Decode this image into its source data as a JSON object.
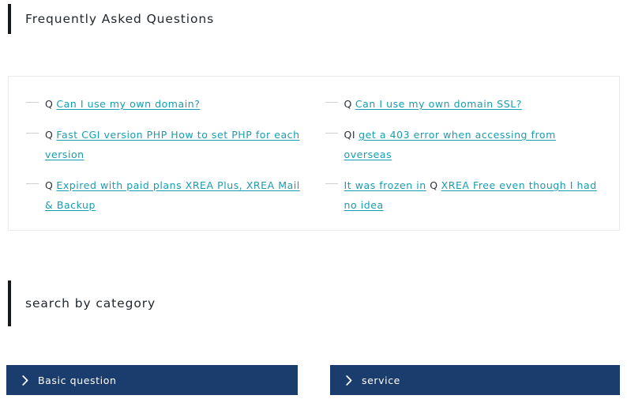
{
  "colors": {
    "accent_bar": "#15191d",
    "link": "#1a9cb0",
    "button_bg": "#1a3d6d",
    "card_border": "#ebebeb",
    "page_bg": "#ffffff",
    "text": "#22282d"
  },
  "faq_section": {
    "heading": "Frequently Asked Questions",
    "columns": [
      {
        "items": [
          {
            "marker": "Q",
            "parts": [
              {
                "type": "link",
                "text": "Can I use my own domain?"
              }
            ]
          },
          {
            "marker": "Q",
            "parts": [
              {
                "type": "link",
                "text": "Fast CGI version PHP How to set PHP for each version"
              }
            ]
          },
          {
            "marker": "Q",
            "parts": [
              {
                "type": "link",
                "text": "Expired with paid plans XREA Plus, XREA Mail & Backup"
              }
            ]
          }
        ]
      },
      {
        "items": [
          {
            "marker": "Q",
            "parts": [
              {
                "type": "link",
                "text": "Can I use my own domain SSL?"
              }
            ]
          },
          {
            "marker": "QI",
            "parts": [
              {
                "type": "link",
                "text": "get a 403 error when accessing from overseas"
              }
            ]
          },
          {
            "marker": "",
            "parts": [
              {
                "type": "link",
                "text": "It was frozen in"
              },
              {
                "type": "text",
                "text": "Q"
              },
              {
                "type": "link",
                "text": "XREA Free even though I had no idea"
              }
            ]
          }
        ]
      }
    ]
  },
  "category_section": {
    "heading": "search by category",
    "buttons": [
      {
        "label": "Basic question",
        "icon": "chevron-right-icon"
      },
      {
        "label": "service",
        "icon": "chevron-right-icon"
      }
    ]
  }
}
